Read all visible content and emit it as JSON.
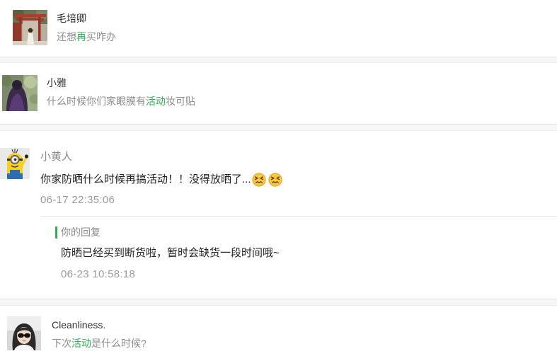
{
  "theme": {
    "accent": "#2fae58"
  },
  "messages": [
    {
      "name": "毛培卿",
      "text_parts": [
        "还想",
        "再",
        "买咋办"
      ]
    },
    {
      "name": "小雅",
      "text_parts": [
        "什么时候你们家眼膜有",
        "活动",
        "妆可贴"
      ]
    },
    {
      "name": "小黄人",
      "text": "你家防晒什么时候再搞活动！！没得放晒了...",
      "emoji": [
        "confounded-face-icon",
        "confounded-face-icon"
      ],
      "time": "06-17 22:35:06",
      "reply": {
        "label": "你的回复",
        "text": "防晒已经买到断货啦，暂时会缺货一段时间哦~",
        "time": "06-23 10:58:18"
      }
    },
    {
      "name": "Cleanliness.",
      "text_parts": [
        "下次",
        "活动",
        "是什么时候?"
      ]
    }
  ]
}
